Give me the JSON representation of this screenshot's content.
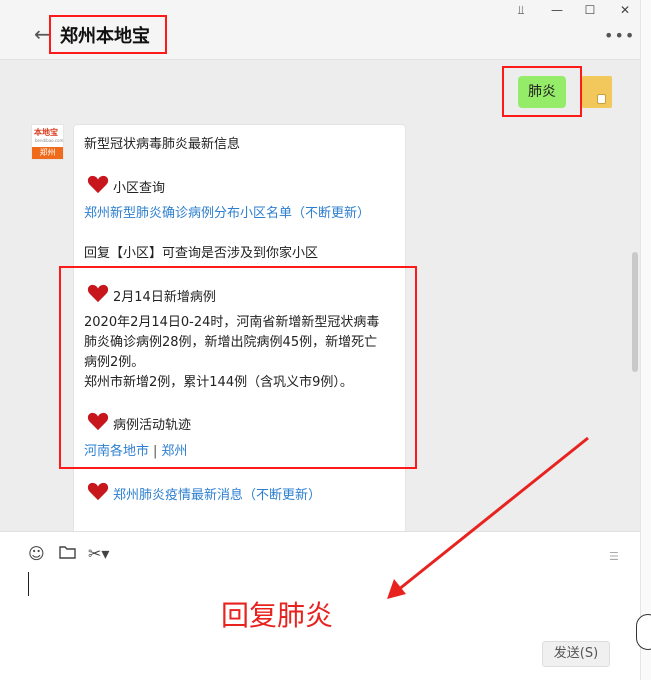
{
  "window": {
    "pin_icon": "pin-icon",
    "minimize_icon": "minimize-icon",
    "maximize_icon": "maximize-icon",
    "close_icon": "close-icon"
  },
  "header": {
    "back_icon": "back-arrow-icon",
    "title": "郑州本地宝",
    "more_icon": "more-dots-icon"
  },
  "messages": {
    "me": {
      "text": "肺炎"
    },
    "bot": {
      "avatar": {
        "brand": "本地宝",
        "sub": "bendibao.com",
        "city": "郑州"
      },
      "heading": "新型冠状病毒肺炎最新信息",
      "section1_title": "小区查询",
      "section1_link": "郑州新型肺炎确诊病例分布小区名单（不断更新）",
      "reply_hint": "回复【小区】可查询是否涉及到你家小区",
      "section2_title": "2月14日新增病例",
      "section2_lines": [
        "2020年2月14日0-24时，河南省新增新型冠状病毒",
        "肺炎确诊病例28例，新增出院病例45例，新增死亡",
        "病例2例。",
        "郑州市新增2例，累计144例（含巩义市9例）。"
      ],
      "section3_title": "病例活动轨迹",
      "section3_link_a": "河南各地市",
      "section3_sep": "|",
      "section3_link_b": "郑州",
      "section4_link": "郑州肺炎疫情最新消息（不断更新）"
    }
  },
  "composer": {
    "emoji_icon": "emoji-icon",
    "folder_icon": "folder-icon",
    "scissors_icon": "scissors-icon",
    "send_label": "发送(S)"
  },
  "annotation": {
    "text": "回复肺炎"
  },
  "colors": {
    "accent_red": "#ff1a1a",
    "bubble_green": "#95ec69",
    "link_blue": "#2d7fd0"
  }
}
